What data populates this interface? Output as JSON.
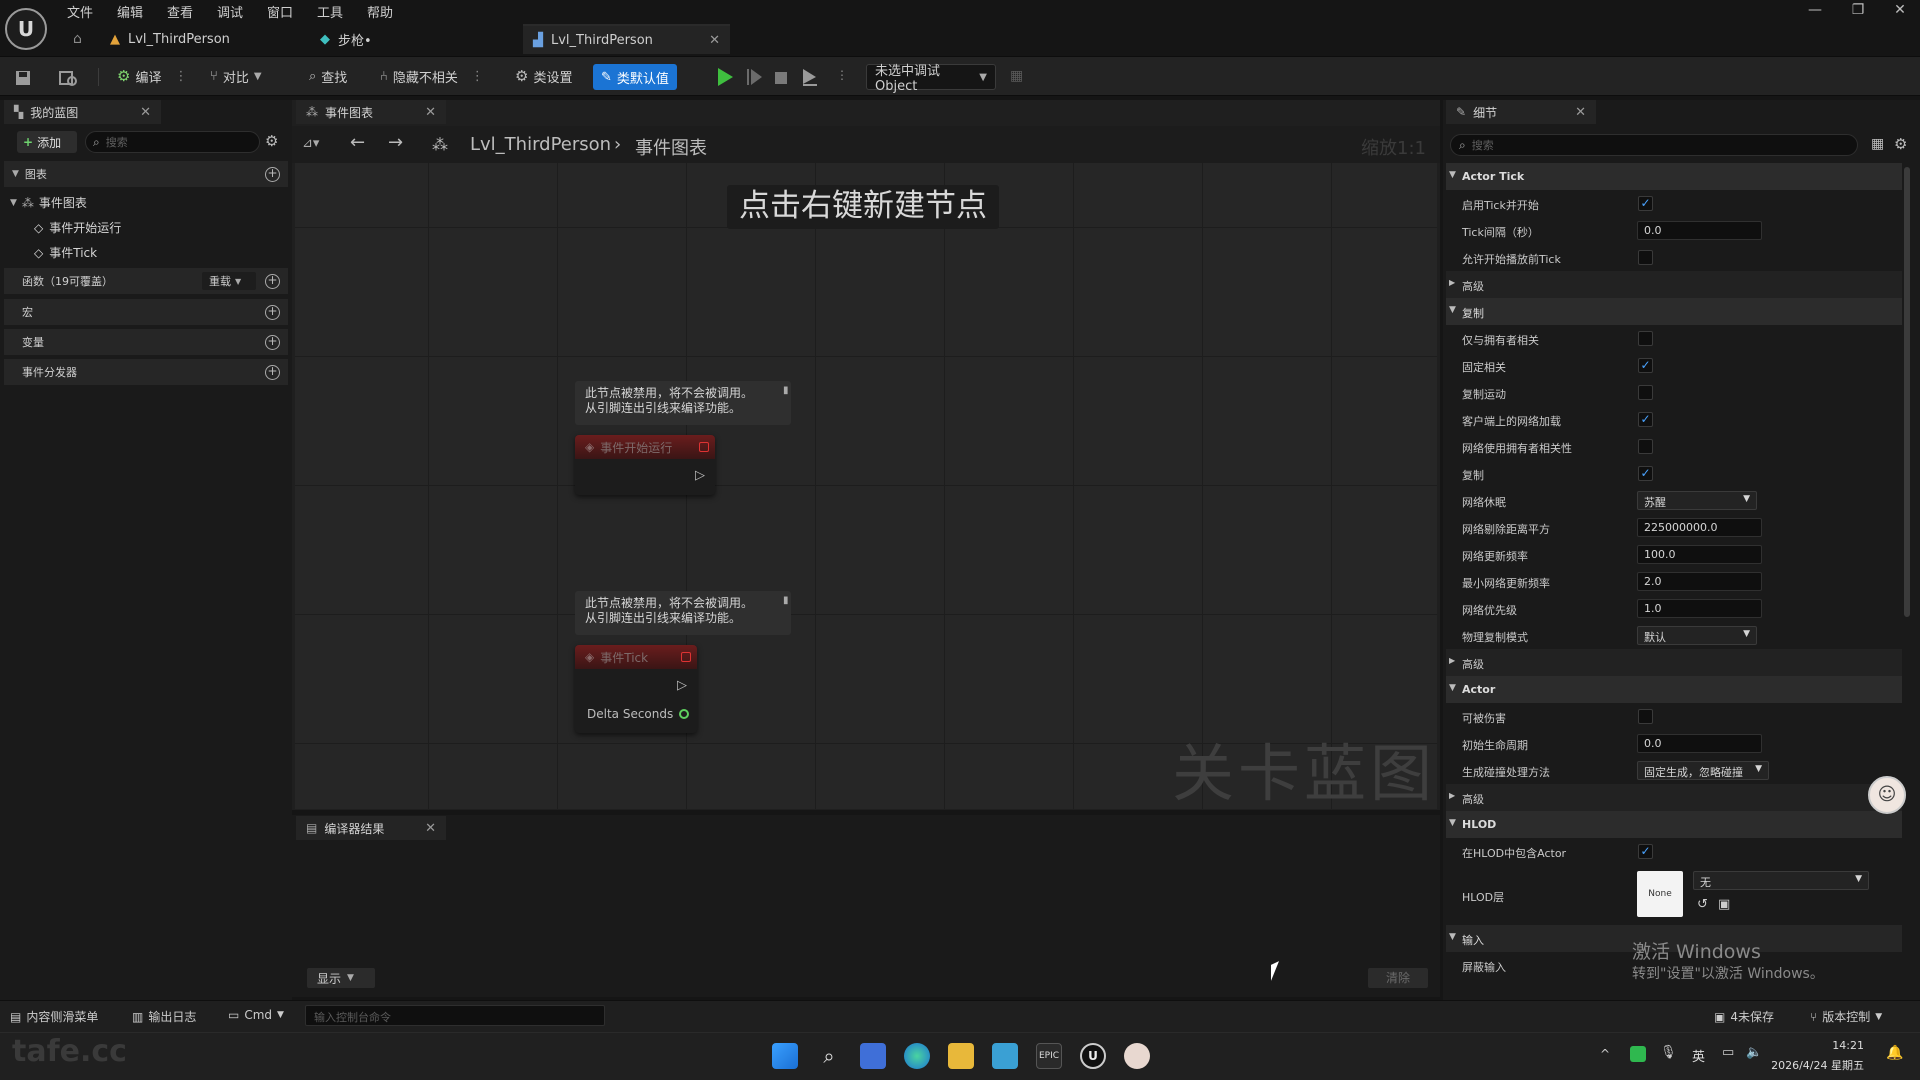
{
  "menu": [
    "文件",
    "编辑",
    "查看",
    "调试",
    "窗口",
    "工具",
    "帮助"
  ],
  "doc_tabs": [
    {
      "label": "Lvl_ThirdPerson"
    },
    {
      "label": "步枪•"
    },
    {
      "label": "Lvl_ThirdPerson"
    }
  ],
  "toolbar": {
    "compile": "编译",
    "diff": "对比",
    "find": "查找",
    "hide_unrelated": "隐藏不相关",
    "class_settings": "类设置",
    "class_defaults": "类默认值",
    "debug_object": "未选中调试Object"
  },
  "left_panel": {
    "tab": "我的蓝图",
    "add": "添加",
    "search_placeholder": "搜索",
    "graphs": "图表",
    "event_graph": "事件图表",
    "event_begin": "事件开始运行",
    "event_tick": "事件Tick",
    "functions": "函数（19可覆盖）",
    "override": "重载",
    "macros": "宏",
    "variables": "变量",
    "dispatchers": "事件分发器"
  },
  "graph": {
    "tab": "事件图表",
    "breadcrumb_root": "Lvl_ThirdPerson",
    "breadcrumb_leaf": "事件图表",
    "zoom": "缩放1:1",
    "hint": "点击右键新建节点",
    "watermark": "关卡蓝图",
    "comment_line1": "此节点被禁用，将不会被调用。",
    "comment_line2": "从引脚连出引线来编译功能。",
    "node1_title": "事件开始运行",
    "node2_title": "事件Tick",
    "node2_pin": "Delta Seconds"
  },
  "compiler": {
    "tab": "编译器结果",
    "show": "显示",
    "clear": "清除"
  },
  "details": {
    "tab": "细节",
    "search_placeholder": "搜索",
    "actor_tick": "Actor Tick",
    "tick_enable": "启用Tick并开始",
    "tick_interval": "Tick间隔（秒）",
    "tick_interval_val": "0.0",
    "tick_before_play": "允许开始播放前Tick",
    "advanced": "高级",
    "replication": "复制",
    "only_owner": "仅与拥有者相关",
    "always_relevant": "固定相关",
    "replicate_movement": "复制运动",
    "net_load_client": "客户端上的网络加载",
    "net_owner_relevancy": "网络使用拥有者相关性",
    "replicates": "复制",
    "net_dormancy": "网络休眠",
    "net_dormancy_val": "苏醒",
    "net_cull_dist": "网络剔除距离平方",
    "net_cull_dist_val": "225000000.0",
    "net_update_freq": "网络更新频率",
    "net_update_freq_val": "100.0",
    "min_net_update_freq": "最小网络更新频率",
    "min_net_update_freq_val": "2.0",
    "net_priority": "网络优先级",
    "net_priority_val": "1.0",
    "physics_rep": "物理复制模式",
    "physics_rep_val": "默认",
    "actor": "Actor",
    "can_be_damaged": "可被伤害",
    "initial_lifespan": "初始生命周期",
    "initial_lifespan_val": "0.0",
    "spawn_collision": "生成碰撞处理方法",
    "spawn_collision_val": "固定生成，忽略碰撞",
    "hlod": "HLOD",
    "include_in_hlod": "在HLOD中包含Actor",
    "hlod_layer": "HLOD层",
    "hlod_thumb": "None",
    "hlod_layer_val": "无",
    "input": "输入",
    "block_input": "屏蔽输入"
  },
  "activation": {
    "line1": "激活 Windows",
    "line2": "转到\"设置\"以激活 Windows。"
  },
  "statusbar": {
    "content_drawer": "内容侧滑菜单",
    "output_log": "输出日志",
    "cmd": "Cmd",
    "console_placeholder": "输入控制台命令",
    "unsaved": "4未保存",
    "source_control": "版本控制"
  },
  "taskbar": {
    "time": "14:21",
    "date": "2026/4/24 星期五",
    "ime": "英"
  },
  "watermark_site": "tafe.cc",
  "colors": {
    "accent": "#1b74d4",
    "play": "#3fbf3f",
    "event_head": "#6a1d1d",
    "check": "#4aa3ff"
  }
}
